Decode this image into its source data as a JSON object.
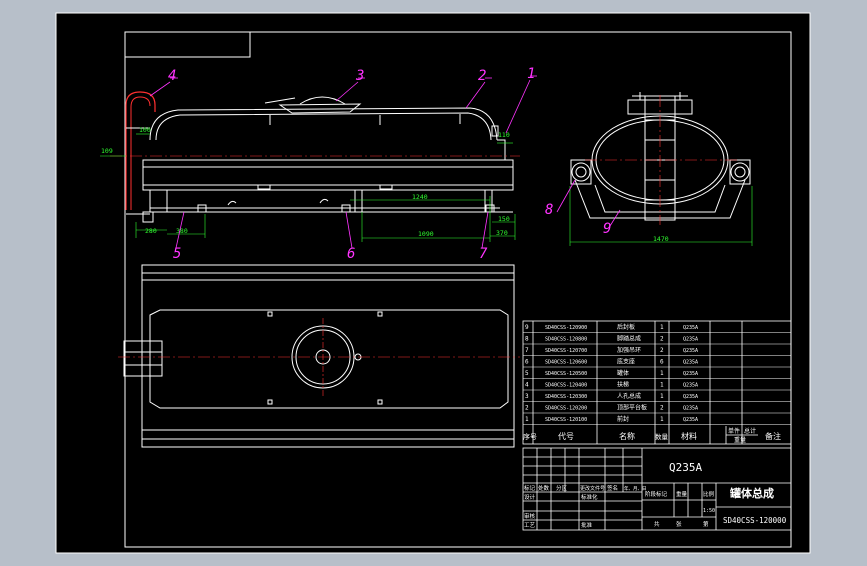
{
  "colors": {
    "background": "#b7bfc9",
    "sheet": "#000000",
    "line": "#ffffff",
    "balloon": "#ff33ff",
    "dimension": "#2fff2f",
    "centerline": "#ff3030",
    "table_text": "#ffffff"
  },
  "front_view": {
    "balloons": [
      "1",
      "2",
      "3",
      "4",
      "5",
      "6",
      "7"
    ],
    "dims": {
      "d100": "100",
      "d110": "110",
      "d109": "109",
      "d280": "280",
      "d380": "380",
      "d1240": "1240",
      "d1090": "1090",
      "d370": "370",
      "d150": "150"
    }
  },
  "side_view": {
    "balloons": [
      "8",
      "9"
    ],
    "dims": {
      "width": "1470"
    }
  },
  "bom": {
    "header": {
      "no": "序号",
      "code": "代号",
      "name": "名称",
      "qty": "数量",
      "material": "材料",
      "unit_weight": "单件",
      "total_weight": "总计",
      "weight": "重量",
      "remark": "备注"
    },
    "rows": [
      {
        "no": "9",
        "code": "SD40CSS-120900",
        "name": "后封板",
        "qty": "1",
        "material": "Q235A"
      },
      {
        "no": "8",
        "code": "SD40CSS-120800",
        "name": "脚踏总成",
        "qty": "2",
        "material": "Q235A"
      },
      {
        "no": "7",
        "code": "SD40CSS-120700",
        "name": "加强吊环",
        "qty": "2",
        "material": "Q235A"
      },
      {
        "no": "6",
        "code": "SD40CSS-120600",
        "name": "底支座",
        "qty": "6",
        "material": "Q235A"
      },
      {
        "no": "5",
        "code": "SD40CSS-120500",
        "name": "罐体",
        "qty": "1",
        "material": "Q235A"
      },
      {
        "no": "4",
        "code": "SD40CSS-120400",
        "name": "扶梯",
        "qty": "1",
        "material": "Q235A"
      },
      {
        "no": "3",
        "code": "SD40CSS-120300",
        "name": "人孔总成",
        "qty": "1",
        "material": "Q235A"
      },
      {
        "no": "2",
        "code": "SD40CSS-120200",
        "name": "顶部平台板",
        "qty": "2",
        "material": "Q235A"
      },
      {
        "no": "1",
        "code": "SD40CSS-120100",
        "name": "前封",
        "qty": "1",
        "material": "Q235A"
      }
    ]
  },
  "title_block": {
    "material": "Q235A",
    "drawing_title": "罐体总成",
    "drawing_number": "SD40CSS-120000",
    "scale": "1:50",
    "row_mark": "标记",
    "row_count": "处数",
    "row_zone": "分区",
    "row_doc": "更改文件号",
    "row_sign": "签名",
    "row_date": "年、月、日",
    "design": "设计",
    "standard": "标准化",
    "review": "审核",
    "process": "工艺",
    "approve": "批准",
    "stage_mark": "阶段标记",
    "weight": "重量",
    "ratio": "比例",
    "total": "共",
    "sheet": "张",
    "page": "第"
  }
}
